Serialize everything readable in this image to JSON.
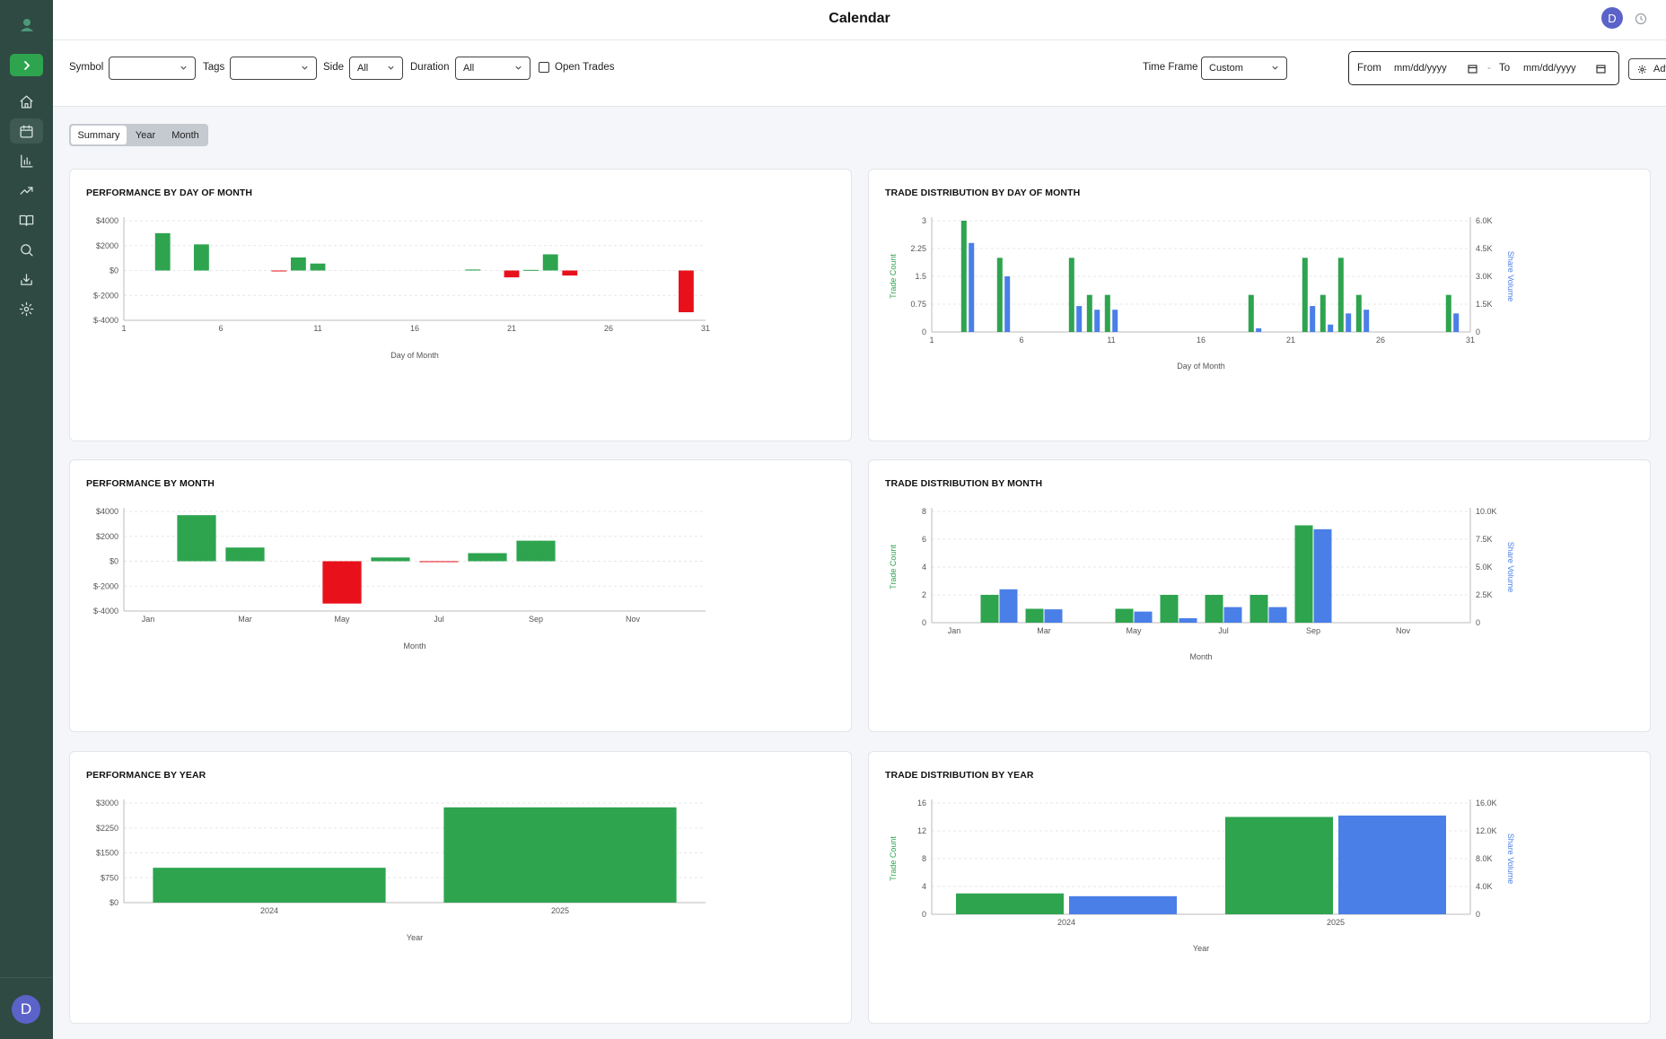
{
  "app": {
    "title": "Calendar",
    "user_initial": "D"
  },
  "filters": {
    "symbol_label": "Symbol",
    "symbol_value": "",
    "tags_label": "Tags",
    "tags_value": "",
    "side_label": "Side",
    "side_value": "All",
    "duration_label": "Duration",
    "duration_value": "All",
    "open_trades_label": "Open Trades",
    "timeframe_label": "Time Frame",
    "timeframe_value": "Custom",
    "from_label": "From",
    "from_value": "mm/dd/yyyy",
    "to_label": "To",
    "to_value": "mm/dd/yyyy",
    "advanced_label": "Advanced"
  },
  "tabs": [
    {
      "label": "Summary",
      "active": true
    },
    {
      "label": "Year"
    },
    {
      "label": "Month"
    }
  ],
  "sidebar": {
    "items": [
      "home-icon",
      "calendar-icon",
      "bar-chart-icon",
      "trend-icon",
      "book-icon",
      "search-icon",
      "import-icon",
      "settings-icon"
    ],
    "active": 1
  },
  "cards": {
    "perf_day": {
      "title": "PERFORMANCE BY DAY OF MONTH"
    },
    "dist_day": {
      "title": "TRADE DISTRIBUTION BY DAY OF MONTH"
    },
    "perf_month": {
      "title": "PERFORMANCE BY MONTH"
    },
    "dist_month": {
      "title": "TRADE DISTRIBUTION BY MONTH"
    },
    "perf_year": {
      "title": "PERFORMANCE BY YEAR"
    },
    "dist_year": {
      "title": "TRADE DISTRIBUTION BY YEAR"
    }
  },
  "colors": {
    "positive": "#2ea44f",
    "negative": "#e8101a",
    "volume": "#4a7fe8",
    "grid": "#e5e7eb",
    "axis": "#555555"
  },
  "chart_data": [
    {
      "id": "perf_day",
      "type": "bar",
      "xlabel": "Day of Month",
      "ylabel": "",
      "x_ticks": [
        "1",
        "6",
        "11",
        "16",
        "21",
        "26",
        "31"
      ],
      "y_ticks": [
        "$4000",
        "$2000",
        "$0",
        "$-2000",
        "$-4000"
      ],
      "ylim": [
        -4000,
        4000
      ],
      "xlim": [
        1,
        31
      ],
      "x": [
        3,
        5,
        9,
        10,
        11,
        19,
        21,
        22,
        23,
        24,
        30
      ],
      "values": [
        3000,
        2100,
        -60,
        1050,
        560,
        80,
        -550,
        50,
        1300,
        -400,
        -3350
      ]
    },
    {
      "id": "dist_day",
      "type": "bar",
      "xlabel": "Day of Month",
      "ylabel": "Trade Count",
      "ylabel2": "Share Volume",
      "x_ticks": [
        "1",
        "6",
        "11",
        "16",
        "21",
        "26",
        "31"
      ],
      "y_ticks": [
        "3",
        "2.25",
        "1.5",
        "0.75",
        "0"
      ],
      "y2_ticks": [
        "6.0K",
        "4.5K",
        "3.0K",
        "1.5K",
        "0"
      ],
      "ylim": [
        0,
        3
      ],
      "y2lim": [
        0,
        6000
      ],
      "xlim": [
        1,
        31
      ],
      "x": [
        3,
        5,
        9,
        10,
        11,
        19,
        22,
        23,
        24,
        25,
        30
      ],
      "series": [
        {
          "name": "Trade Count",
          "values": [
            3,
            2,
            2,
            1,
            1,
            1,
            2,
            1,
            2,
            1,
            1
          ]
        },
        {
          "name": "Share Volume",
          "values": [
            4800,
            3000,
            1400,
            1200,
            1200,
            200,
            1400,
            400,
            1000,
            1200,
            1000
          ]
        }
      ]
    },
    {
      "id": "perf_month",
      "type": "bar",
      "xlabel": "Month",
      "ylabel": "",
      "x_ticks": [
        "Jan",
        "Mar",
        "May",
        "Jul",
        "Sep",
        "Nov"
      ],
      "y_ticks": [
        "$4000",
        "$2000",
        "$0",
        "$-2000",
        "$-4000"
      ],
      "ylim": [
        -4000,
        4000
      ],
      "categories": [
        "Jan",
        "Feb",
        "Mar",
        "Apr",
        "May",
        "Jun",
        "Jul",
        "Aug",
        "Sep",
        "Oct",
        "Nov",
        "Dec"
      ],
      "values": [
        0,
        3700,
        1100,
        0,
        -3400,
        300,
        -60,
        650,
        1650,
        0,
        0,
        0
      ]
    },
    {
      "id": "dist_month",
      "type": "bar",
      "xlabel": "Month",
      "ylabel": "Trade Count",
      "ylabel2": "Share Volume",
      "x_ticks": [
        "Jan",
        "Mar",
        "May",
        "Jul",
        "Sep",
        "Nov"
      ],
      "y_ticks": [
        "8",
        "6",
        "4",
        "2",
        "0"
      ],
      "y2_ticks": [
        "10.0K",
        "7.5K",
        "5.0K",
        "2.5K",
        "0"
      ],
      "ylim": [
        0,
        8
      ],
      "y2lim": [
        0,
        10000
      ],
      "categories": [
        "Jan",
        "Feb",
        "Mar",
        "Apr",
        "May",
        "Jun",
        "Jul",
        "Aug",
        "Sep",
        "Oct",
        "Nov",
        "Dec"
      ],
      "series": [
        {
          "name": "Trade Count",
          "values": [
            0,
            2,
            1,
            0,
            1,
            2,
            2,
            2,
            7,
            0,
            0,
            0
          ]
        },
        {
          "name": "Share Volume",
          "values": [
            0,
            3000,
            1200,
            0,
            1000,
            400,
            1400,
            1400,
            8400,
            0,
            0,
            0
          ]
        }
      ]
    },
    {
      "id": "perf_year",
      "type": "bar",
      "xlabel": "Year",
      "ylabel": "",
      "y_ticks": [
        "$3000",
        "$2250",
        "$1500",
        "$750",
        "$0"
      ],
      "ylim": [
        0,
        3000
      ],
      "categories": [
        "2024",
        "2025"
      ],
      "values": [
        1050,
        2870
      ]
    },
    {
      "id": "dist_year",
      "type": "bar",
      "xlabel": "Year",
      "ylabel": "Trade Count",
      "ylabel2": "Share Volume",
      "y_ticks": [
        "16",
        "12",
        "8",
        "4",
        "0"
      ],
      "y2_ticks": [
        "16.0K",
        "12.0K",
        "8.0K",
        "4.0K",
        "0"
      ],
      "ylim": [
        0,
        16
      ],
      "y2lim": [
        0,
        16000
      ],
      "categories": [
        "2024",
        "2025"
      ],
      "series": [
        {
          "name": "Trade Count",
          "values": [
            3,
            14
          ]
        },
        {
          "name": "Share Volume",
          "values": [
            2600,
            14200
          ]
        }
      ]
    }
  ]
}
